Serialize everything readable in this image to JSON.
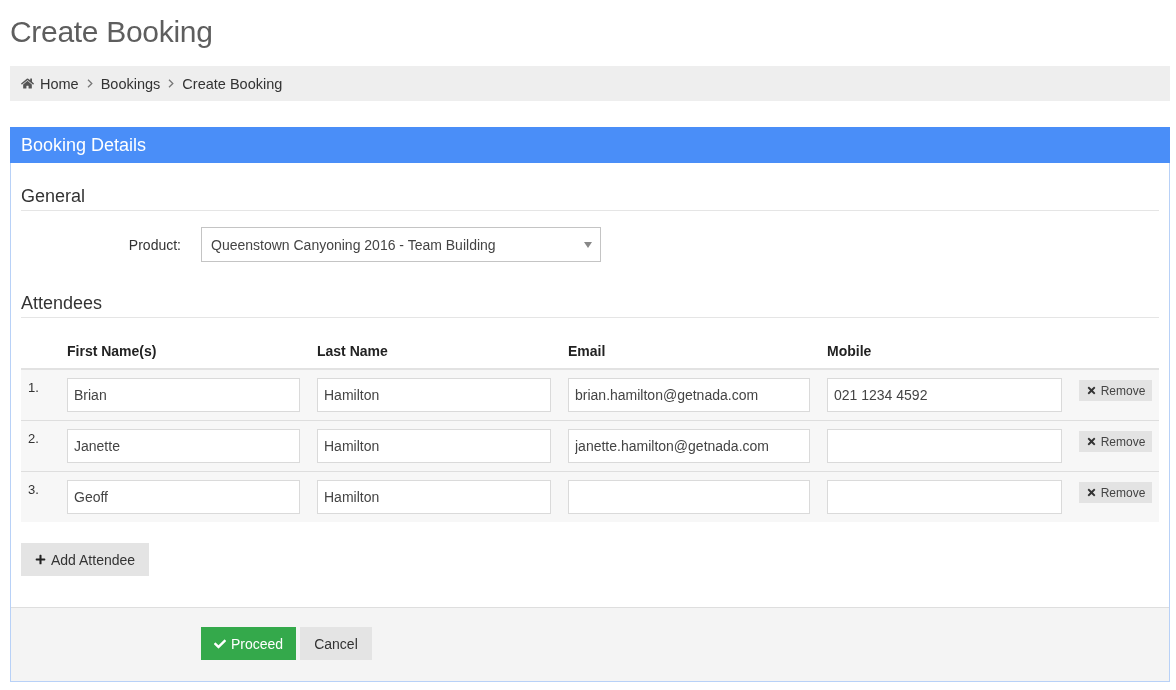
{
  "page": {
    "title": "Create Booking"
  },
  "breadcrumb": [
    {
      "label": "Home"
    },
    {
      "label": "Bookings"
    },
    {
      "label": "Create Booking"
    }
  ],
  "panel": {
    "title": "Booking Details",
    "general": {
      "heading": "General",
      "product": {
        "label": "Product:",
        "value": "Queenstown Canyoning 2016 - Team Building"
      }
    },
    "attendees": {
      "heading": "Attendees",
      "columns": [
        "First Name(s)",
        "Last Name",
        "Email",
        "Mobile"
      ],
      "rows": [
        {
          "number": "1.",
          "first_name": "Brian",
          "last_name": "Hamilton",
          "email": "brian.hamilton@getnada.com",
          "mobile": "021 1234 4592",
          "remove": "Remove"
        },
        {
          "number": "2.",
          "first_name": "Janette",
          "last_name": "Hamilton",
          "email": "janette.hamilton@getnada.com",
          "remove": "Remove"
        },
        {
          "number": "3.",
          "first_name": "Geoff",
          "last_name": "Hamilton",
          "remove": "Remove"
        }
      ],
      "add_button": "Add Attendee"
    },
    "footer_buttons": [
      {
        "label": "Proceed",
        "kind": "primary"
      },
      {
        "label": "Cancel",
        "kind": "default"
      }
    ]
  }
}
